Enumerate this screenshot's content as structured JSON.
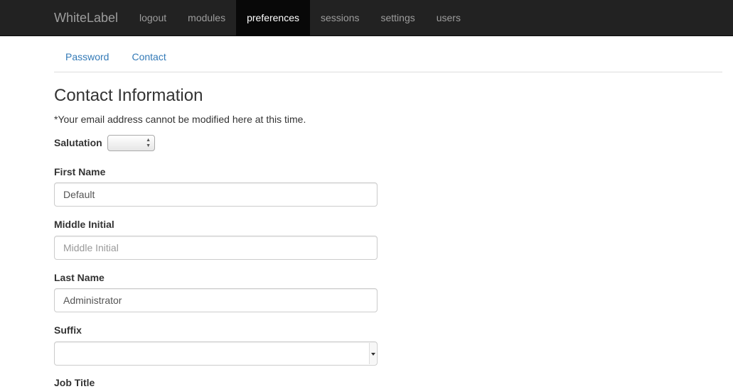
{
  "navbar": {
    "brand": "WhiteLabel",
    "items": [
      {
        "label": "logout",
        "active": false
      },
      {
        "label": "modules",
        "active": false
      },
      {
        "label": "preferences",
        "active": true
      },
      {
        "label": "sessions",
        "active": false
      },
      {
        "label": "settings",
        "active": false
      },
      {
        "label": "users",
        "active": false
      }
    ]
  },
  "subtabs": [
    {
      "label": "Password"
    },
    {
      "label": "Contact"
    }
  ],
  "page": {
    "title": "Contact Information",
    "note": "*Your email address cannot be modified here at this time."
  },
  "form": {
    "salutation_label": "Salutation",
    "salutation_value": "",
    "first_name_label": "First Name",
    "first_name_value": "Default",
    "middle_initial_label": "Middle Initial",
    "middle_initial_placeholder": "Middle Initial",
    "last_name_label": "Last Name",
    "last_name_value": "Administrator",
    "suffix_label": "Suffix",
    "suffix_value": "",
    "job_title_label": "Job Title"
  },
  "colors": {
    "navbar_bg": "#222222",
    "navbar_active_bg": "#080808",
    "link": "#337ab7"
  }
}
